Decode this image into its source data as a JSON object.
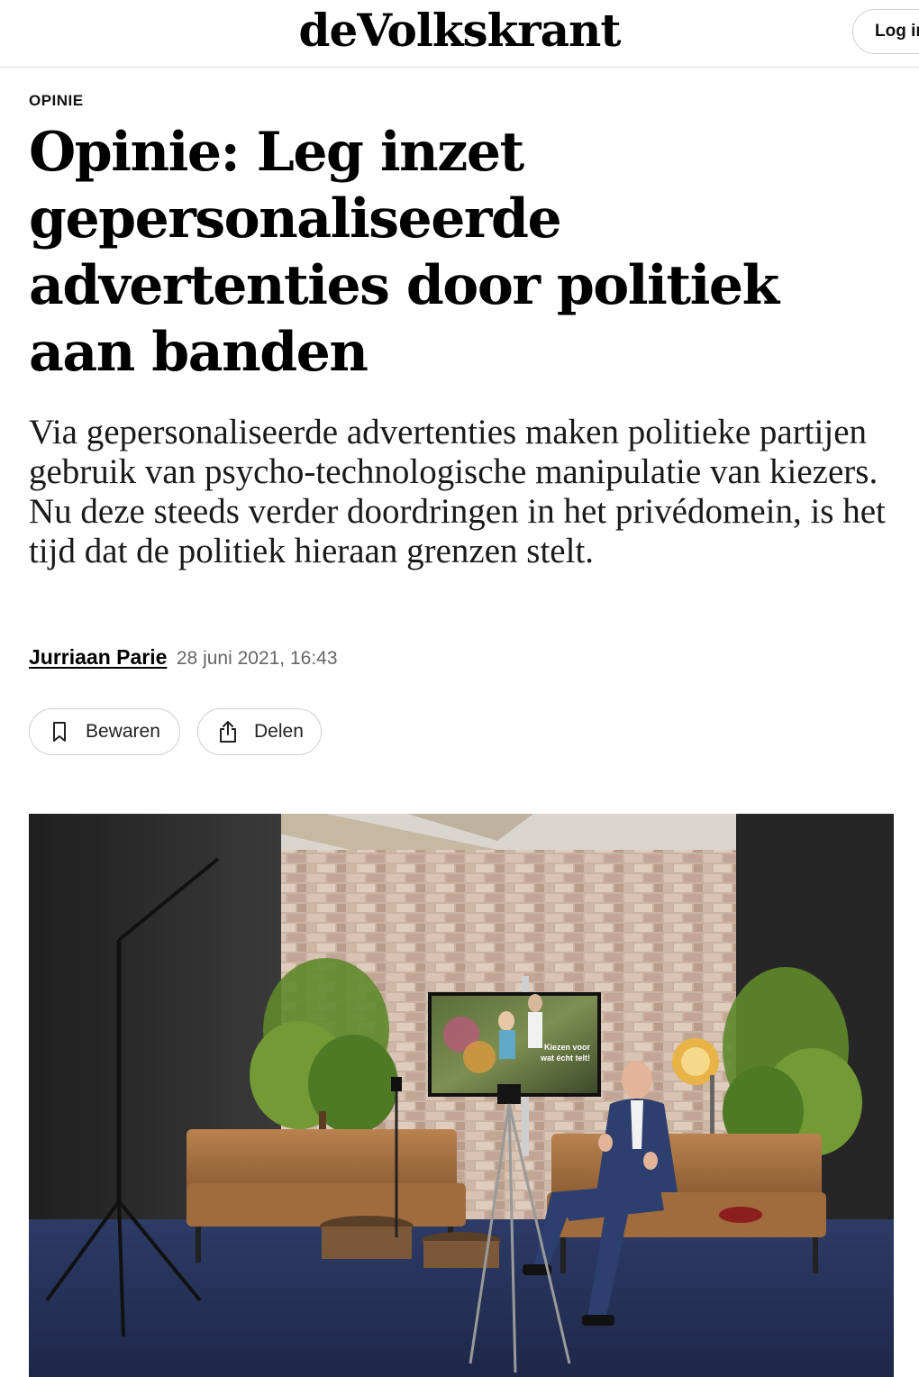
{
  "header": {
    "logo": "deVolkskrant",
    "login_label": "Log in"
  },
  "article": {
    "kicker": "OPINIE",
    "title": "Opinie: Leg inzet gepersonaliseerde advertenties door politiek aan banden",
    "lead": "Via gepersonaliseerde advertenties maken politieke partijen gebruik van psycho-technologische manipulatie van kiezers. Nu deze steeds verder doordringen in het privédomein, is het tijd dat de politiek hieraan grenzen stelt.",
    "author": "Jurriaan Parie",
    "date": "28 juni 2021, 16:43"
  },
  "actions": {
    "save_label": "Bewaren",
    "save_icon": "bookmark-icon",
    "share_label": "Delen",
    "share_icon": "share-icon"
  },
  "photo": {
    "screen_text_line1": "Kiezen voor",
    "screen_text_line2": "wat écht telt!"
  }
}
